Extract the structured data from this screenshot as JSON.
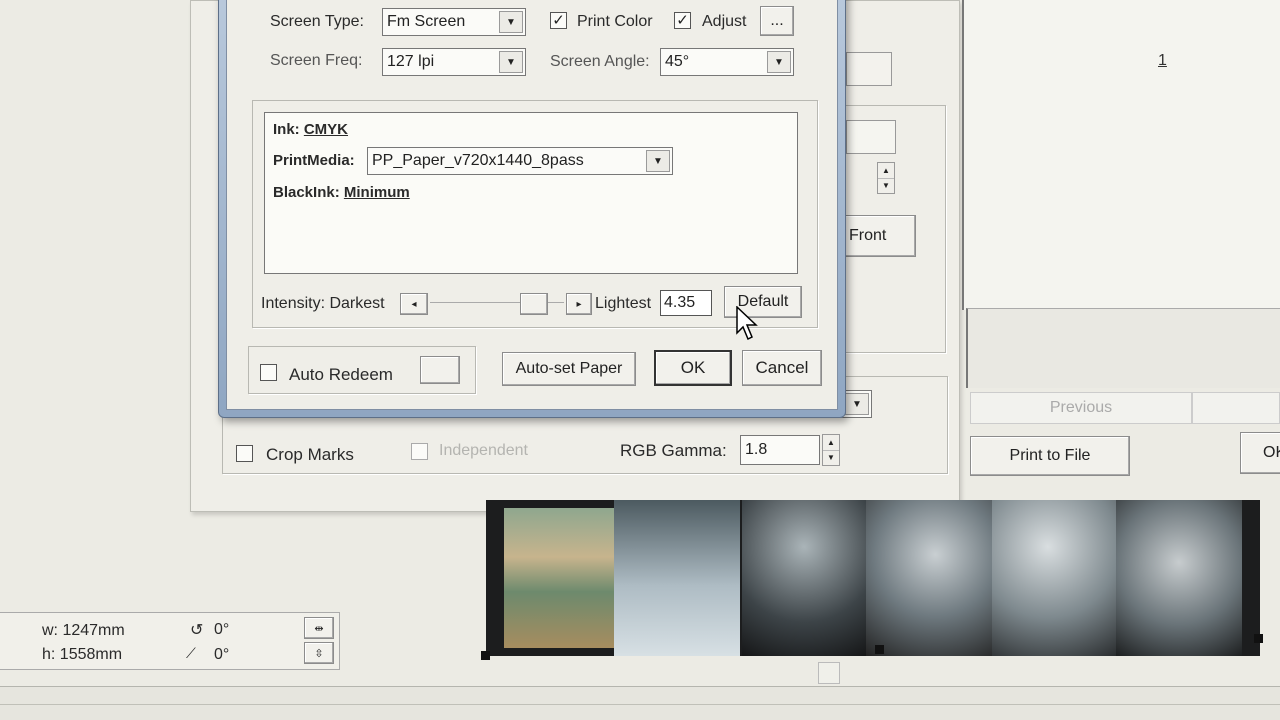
{
  "colors": {
    "background": "#ecebe4",
    "dialog": "#efeee8",
    "window_frame": "#9fb3cc",
    "film": "#1c1d1e"
  },
  "dialog": {
    "screen_type_label": "Screen Type:",
    "screen_type_value": "Fm Screen",
    "print_color_label": "Print Color",
    "adjust_label": "Adjust",
    "ellipsis": "...",
    "screen_freq_label": "Screen Freq:",
    "screen_freq_value": "127 lpi",
    "screen_angle_label": "Screen Angle:",
    "screen_angle_value": "45°",
    "ink_label": "Ink:",
    "ink_value": "CMYK",
    "print_media_label": "PrintMedia:",
    "print_media_value": "PP_Paper_v720x1440_8pass",
    "black_ink_label": "BlackInk:",
    "black_ink_value": "Minimum",
    "intensity_label": "Intensity: Darkest",
    "lightest_label": "Lightest",
    "intensity_value": "4.35",
    "default_button": "Default",
    "auto_redeem_label": "Auto Redeem",
    "auto_set_paper_button": "Auto-set Paper",
    "ok_button": "OK",
    "cancel_button": "Cancel"
  },
  "background": {
    "page_number": "1",
    "front_button": "Front",
    "previous_button": "Previous",
    "print_to_file_button": "Print to File",
    "ok_partial": "OK",
    "crop_marks_label": "Crop Marks",
    "independent_label": "Independent",
    "rgb_gamma_label": "RGB Gamma:",
    "rgb_gamma_value": "1.8"
  },
  "info_panel": {
    "width_label": "w: 1247mm",
    "height_label": "h: 1558mm",
    "rotation": "0°",
    "skew": "0°"
  },
  "icons": {
    "rotate": "rotate-icon",
    "skew": "skew-icon",
    "fit_width": "fit-width-icon",
    "fit_height": "fit-height-icon",
    "cursor": "mouse-cursor-icon"
  }
}
